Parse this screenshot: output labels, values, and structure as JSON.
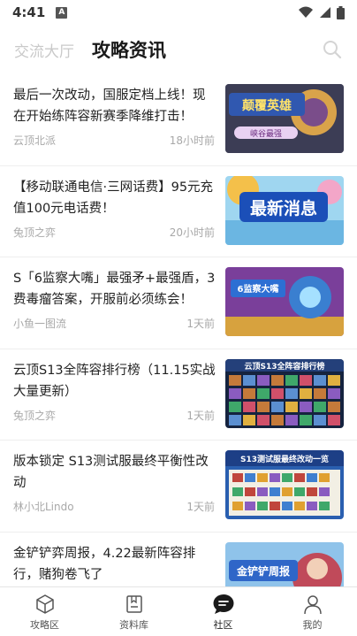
{
  "status_bar": {
    "time": "4:41",
    "sim_glyph": "A"
  },
  "header": {
    "tab_inactive": "交流大厅",
    "tab_active": "攻略资讯"
  },
  "articles": [
    {
      "title": "最后一次改动，国服定档上线！现在开始练阵容新赛季降维打击！",
      "source": "云顶北派",
      "time": "18小时前",
      "thumb_text": "颠覆英雄",
      "thumb_subtext": "峡谷最强"
    },
    {
      "title": "【移动联通电信·三网话费】95元充值100元电话费！",
      "source": "兔顶之弈",
      "time": "20小时前",
      "thumb_text": "最新消息"
    },
    {
      "title": "S「6监察大嘴」最强矛+最强盾，3费毒瘤答案，开服前必须练会！",
      "source": "小鱼一图流",
      "time": "1天前",
      "thumb_text": "6监察大嘴"
    },
    {
      "title": "云顶S13全阵容排行榜（11.15实战大量更新）",
      "source": "兔顶之弈",
      "time": "1天前",
      "thumb_text": "云顶S13全阵容排行榜"
    },
    {
      "title": "版本锁定 S13测试服最终平衡性改动",
      "source": "林小北Lindo",
      "time": "1天前",
      "thumb_text": "S13测试服最终改动一览"
    },
    {
      "title": "金铲铲弈周报，4.22最新阵容排行，赌狗卷飞了",
      "source": "",
      "time": "",
      "thumb_text": "金铲铲周报"
    }
  ],
  "tabbar": [
    {
      "label": "攻略区",
      "icon": "cube-icon"
    },
    {
      "label": "资料库",
      "icon": "book-icon"
    },
    {
      "label": "社区",
      "icon": "chat-bubble-icon"
    },
    {
      "label": "我的",
      "icon": "person-icon"
    }
  ]
}
